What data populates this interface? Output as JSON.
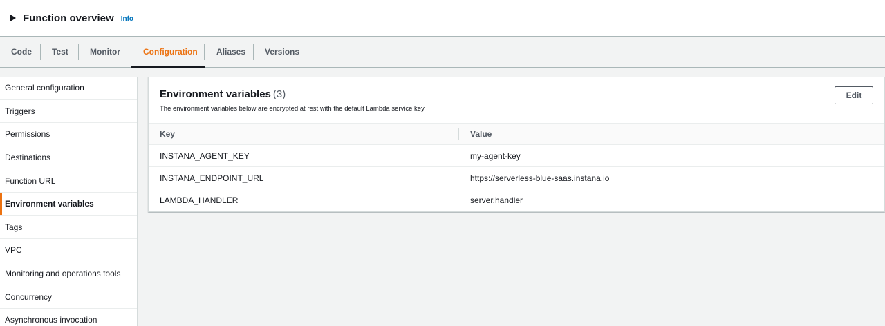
{
  "header": {
    "title": "Function overview",
    "info_label": "Info",
    "caret_icon": "caret-right-icon"
  },
  "tabs": [
    {
      "label": "Code",
      "active": false
    },
    {
      "label": "Test",
      "active": false
    },
    {
      "label": "Monitor",
      "active": false
    },
    {
      "label": "Configuration",
      "active": true
    },
    {
      "label": "Aliases",
      "active": false
    },
    {
      "label": "Versions",
      "active": false
    }
  ],
  "sidebar": {
    "items": [
      {
        "label": "General configuration"
      },
      {
        "label": "Triggers"
      },
      {
        "label": "Permissions"
      },
      {
        "label": "Destinations"
      },
      {
        "label": "Function URL"
      },
      {
        "label": "Environment variables",
        "active": true
      },
      {
        "label": "Tags"
      },
      {
        "label": "VPC"
      },
      {
        "label": "Monitoring and operations tools"
      },
      {
        "label": "Concurrency"
      },
      {
        "label": "Asynchronous invocation"
      }
    ]
  },
  "env_panel": {
    "title": "Environment variables",
    "count": "(3)",
    "description": "The environment variables below are encrypted at rest with the default Lambda service key.",
    "edit_label": "Edit",
    "columns": {
      "key": "Key",
      "value": "Value"
    },
    "rows": [
      {
        "key": "INSTANA_AGENT_KEY",
        "value": "my-agent-key"
      },
      {
        "key": "INSTANA_ENDPOINT_URL",
        "value": "https://serverless-blue-saas.instana.io"
      },
      {
        "key": "LAMBDA_HANDLER",
        "value": "server.handler"
      }
    ]
  },
  "colors": {
    "accent": "#ec7211",
    "link": "#0073bb",
    "text": "#16191f",
    "muted": "#545b64"
  }
}
